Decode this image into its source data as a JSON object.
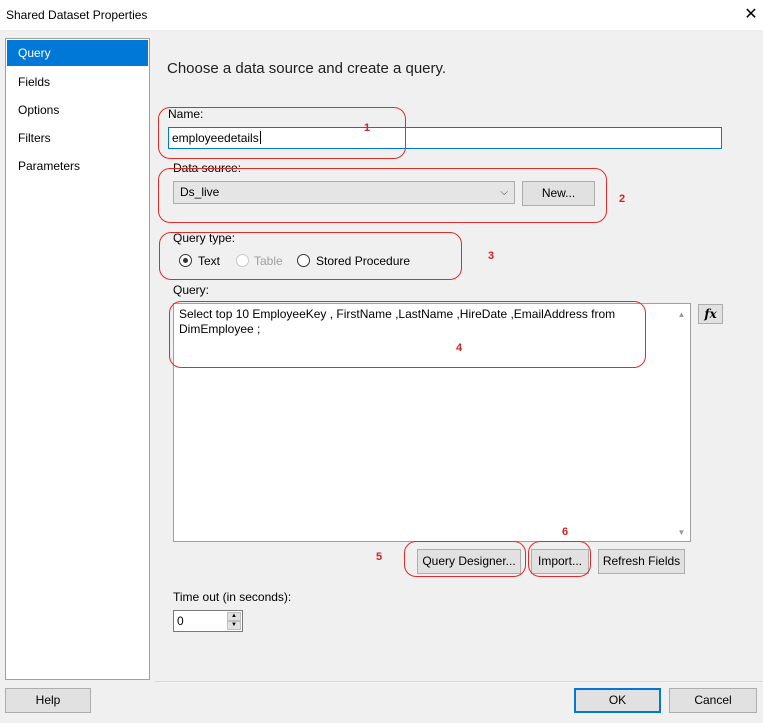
{
  "window": {
    "title": "Shared Dataset Properties",
    "close": "✕"
  },
  "nav": {
    "items": [
      {
        "label": "Query"
      },
      {
        "label": "Fields"
      },
      {
        "label": "Options"
      },
      {
        "label": "Filters"
      },
      {
        "label": "Parameters"
      }
    ],
    "selected": "Query"
  },
  "main": {
    "heading": "Choose a data source and create a query.",
    "name_label": "Name:",
    "name_value": "employeedetails",
    "datasource_label": "Data source:",
    "datasource_value": "Ds_live",
    "new_button": "New...",
    "query_type_label": "Query type:",
    "query_types": [
      {
        "label": "Text",
        "selected": true,
        "enabled": true
      },
      {
        "label": "Table",
        "selected": false,
        "enabled": false
      },
      {
        "label": "Stored Procedure",
        "selected": false,
        "enabled": true
      }
    ],
    "query_label": "Query:",
    "query_text": "Select top 10 EmployeeKey , FirstName ,LastName ,HireDate ,EmailAddress from DimEmployee ;",
    "fx_button": "fx",
    "query_designer_button": "Query Designer...",
    "import_button": "Import...",
    "refresh_fields_button": "Refresh Fields",
    "timeout_label": "Time out (in seconds):",
    "timeout_value": "0"
  },
  "footer": {
    "help": "Help",
    "ok": "OK",
    "cancel": "Cancel"
  },
  "annotations": {
    "color": "#e22a2a",
    "labels": [
      "1",
      "2",
      "3",
      "4",
      "5",
      "6"
    ]
  },
  "colors": {
    "accent": "#0078d7",
    "annotation": "#e22a2a"
  }
}
